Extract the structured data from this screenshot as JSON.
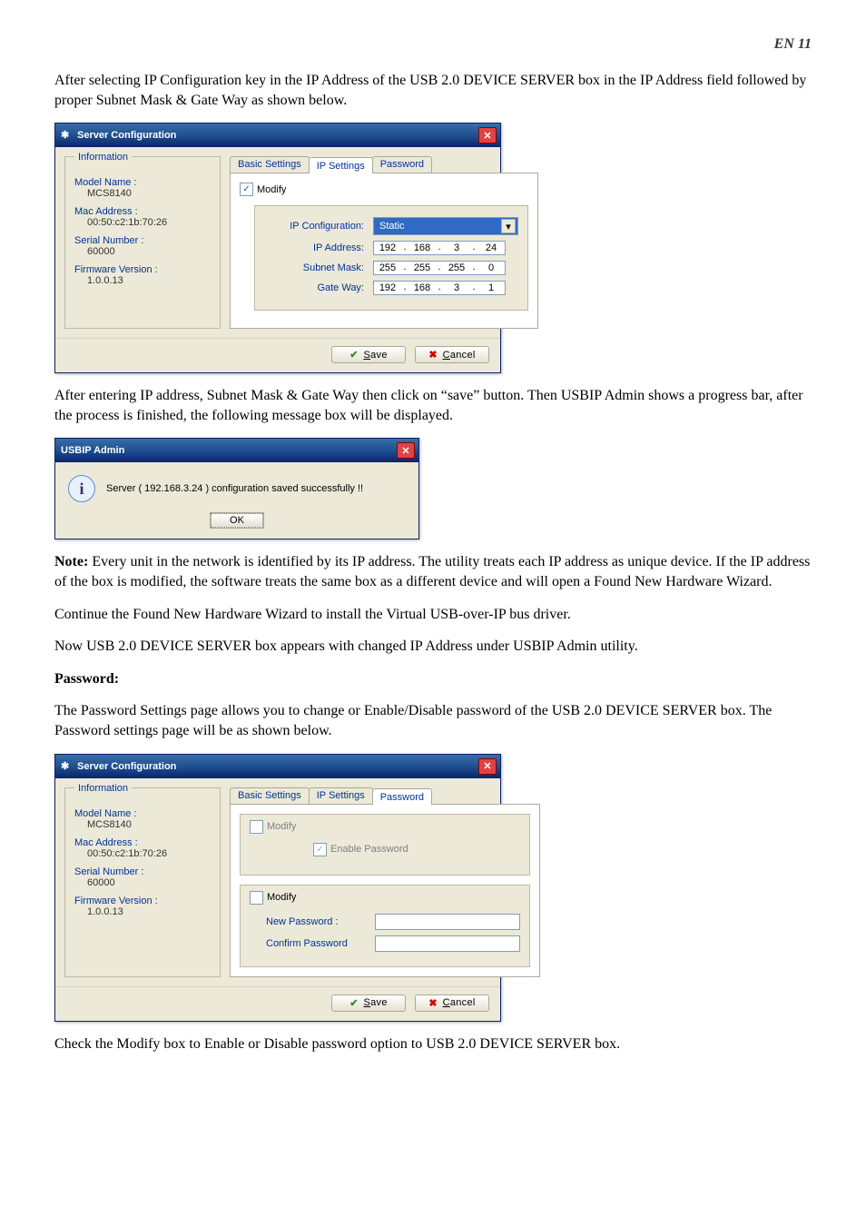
{
  "page_number": "EN 11",
  "para1": "After selecting IP Configuration key in the IP Address of the USB 2.0 DEVICE SERVER box in the IP Address field followed by proper Subnet Mask & Gate Way as shown below.",
  "dialog1": {
    "title": "Server Configuration",
    "info_legend": "Information",
    "model_label": "Model Name :",
    "model_value": "MCS8140",
    "mac_label": "Mac Address :",
    "mac_value": "00:50:c2:1b:70:26",
    "serial_label": "Serial Number :",
    "serial_value": "60000",
    "fw_label": "Firmware Version :",
    "fw_value": "1.0.0.13",
    "tabs": {
      "basic": "Basic Settings",
      "ip": "IP Settings",
      "pw": "Password"
    },
    "modify": "Modify",
    "ipconf_label": "IP Configuration:",
    "ipconf_value": "Static",
    "ipaddr_label": "IP Address:",
    "ip_octets": [
      "192",
      "168",
      "3",
      "24"
    ],
    "subnet_label": "Subnet Mask:",
    "subnet_octets": [
      "255",
      "255",
      "255",
      "0"
    ],
    "gateway_label": "Gate Way:",
    "gateway_octets": [
      "192",
      "168",
      "3",
      "1"
    ],
    "save": "Save",
    "cancel": "Cancel"
  },
  "para2": "After entering IP address, Subnet Mask & Gate Way then click on “save” button. Then USBIP Admin shows a progress bar, after the process is finished, the following message box will be displayed.",
  "msgbox": {
    "title": "USBIP Admin",
    "message": "Server  ( 192.168.3.24 ) configuration saved successfully !!",
    "ok": "OK"
  },
  "note_strong": "Note:",
  "para3": " Every unit in the network is identified by its IP address. The utility treats each IP address as unique device. If the IP address of the box is modified, the software treats the same box as a different device and will open a Found New Hardware Wizard.",
  "para4": "Continue the Found New Hardware Wizard to install the Virtual USB-over-IP bus driver.",
  "para5": "Now USB 2.0 DEVICE SERVER box appears with changed IP Address under USBIP Admin utility.",
  "pw_heading": "Password:",
  "para6": "The Password Settings  page allows you to change or Enable/Disable password of the USB 2.0 DEVICE SERVER box. The Password settings page will be as shown below.",
  "dialog2": {
    "title": "Server Configuration",
    "info_legend": "Information",
    "model_label": "Model Name :",
    "model_value": "MCS8140",
    "mac_label": "Mac Address :",
    "mac_value": "00:50:c2:1b:70:26",
    "serial_label": "Serial Number :",
    "serial_value": "60000",
    "fw_label": "Firmware Version :",
    "fw_value": "1.0.0.13",
    "tabs": {
      "basic": "Basic Settings",
      "ip": "IP Settings",
      "pw": "Password"
    },
    "modify1": "Modify",
    "enable_pw": "Enable Password",
    "modify2": "Modify",
    "new_pw": "New Password :",
    "confirm_pw": "Confirm Password",
    "save": "Save",
    "cancel": "Cancel"
  },
  "caption": "Check the Modify box to Enable or Disable password option to USB 2.0 DEVICE SERVER box."
}
